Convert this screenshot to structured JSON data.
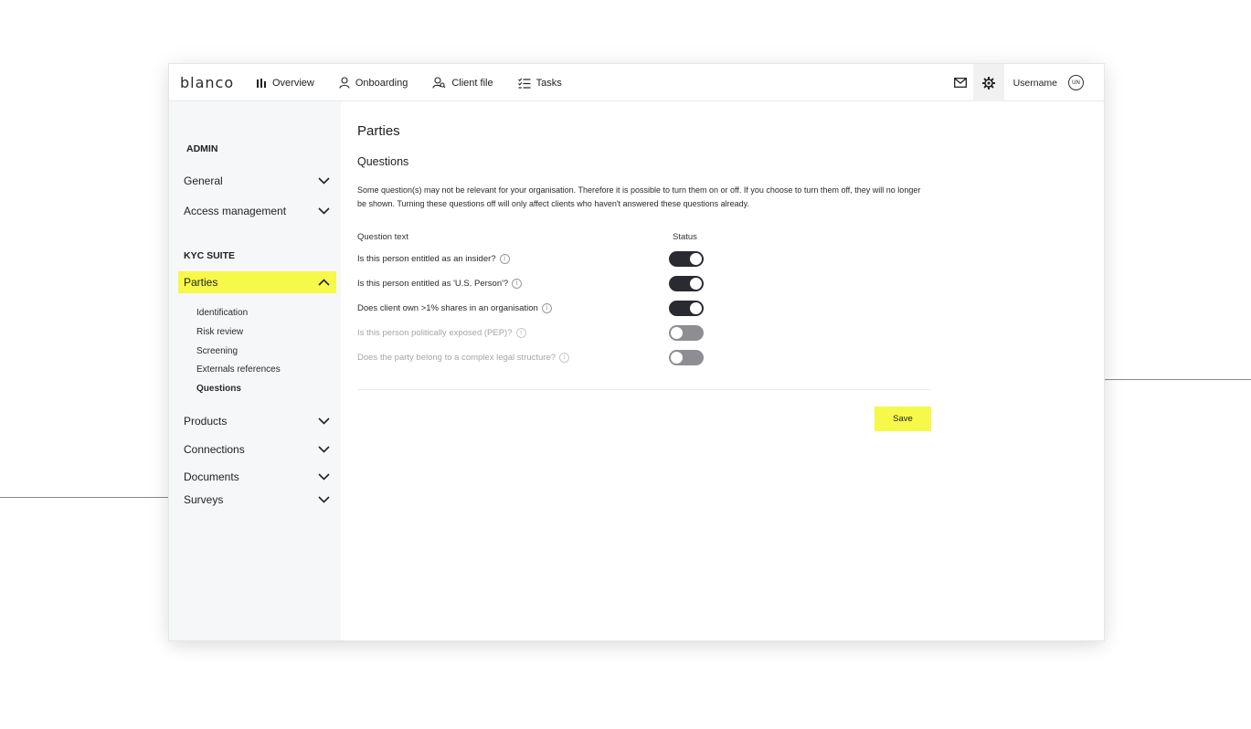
{
  "app": {
    "logo": "blanco"
  },
  "nav": [
    {
      "label": "Overview",
      "icon": "bar-chart-icon"
    },
    {
      "label": "Onboarding",
      "icon": "user-icon"
    },
    {
      "label": "Client file",
      "icon": "user-search-icon"
    },
    {
      "label": "Tasks",
      "icon": "checklist-icon"
    }
  ],
  "topright": {
    "username": "Username",
    "avatar_initials": "UN"
  },
  "sidebar": {
    "admin_heading": "ADMIN",
    "admin_items": [
      {
        "label": "General"
      },
      {
        "label": "Access management"
      }
    ],
    "kyc_heading": "KYC SUITE",
    "parties": {
      "label": "Parties",
      "sub_items": [
        {
          "label": "Identification"
        },
        {
          "label": "Risk review"
        },
        {
          "label": "Screening"
        },
        {
          "label": "Externals references"
        },
        {
          "label": "Questions"
        }
      ]
    },
    "other_items": [
      {
        "label": "Products"
      },
      {
        "label": "Connections"
      },
      {
        "label": "Documents"
      },
      {
        "label": "Surveys"
      }
    ]
  },
  "main": {
    "title": "Parties",
    "section_title": "Questions",
    "description": "Some question(s) may not be relevant for your organisation. Therefore it is possible to turn them on or off. If you choose to turn them off, they will no longer be shown. Turning these questions off will only affect clients who haven't answered these questions already.",
    "col_question": "Question text",
    "col_status": "Status",
    "questions": [
      {
        "text": "Is this person entitled as an insider?",
        "enabled": true
      },
      {
        "text": "Is this person entitled as 'U.S. Person'?",
        "enabled": true
      },
      {
        "text": "Does client own >1% shares in an organisation",
        "enabled": true
      },
      {
        "text": "Is this person politically exposed (PEP)?",
        "enabled": false
      },
      {
        "text": "Does the party belong to a complex legal structure?",
        "enabled": false
      }
    ],
    "info_glyph": "i",
    "save_label": "Save"
  },
  "colors": {
    "accent": "#f6f84a",
    "toggle_on": "#2a2b30",
    "toggle_off": "#8e8e92",
    "sidebar_bg": "#f6f7f9"
  }
}
